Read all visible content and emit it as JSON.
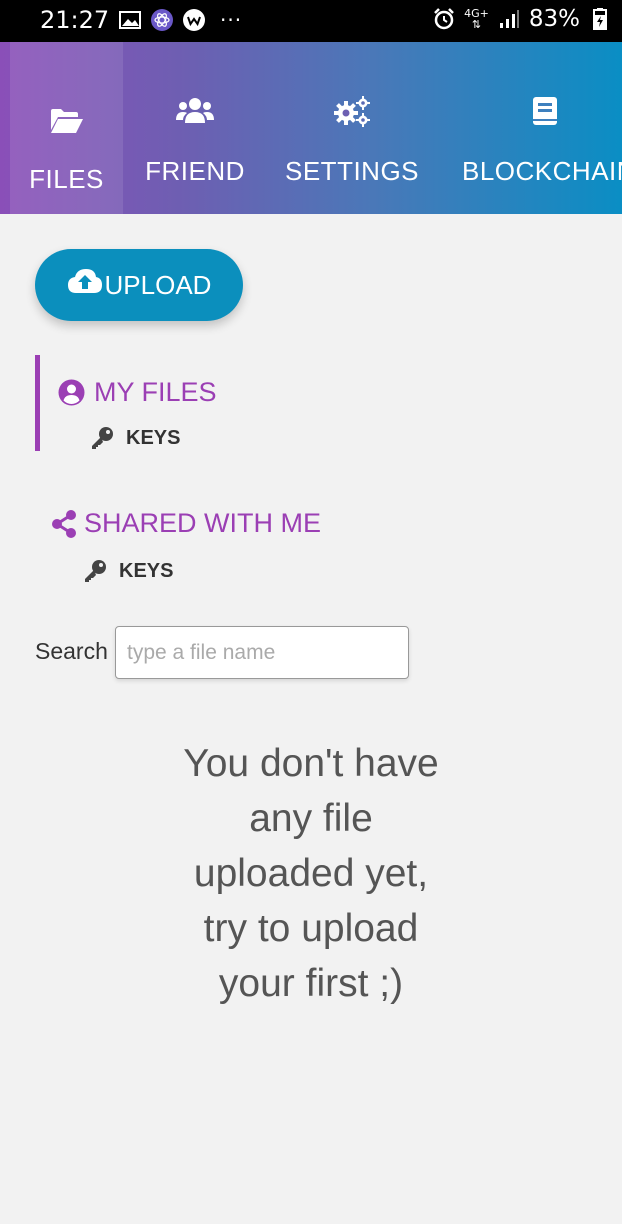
{
  "status_bar": {
    "time": "21:27",
    "dots": "···",
    "network": "4G+",
    "battery": "83%"
  },
  "nav": {
    "tabs": [
      {
        "label": "FILES",
        "icon": "folder-open-icon",
        "active": true
      },
      {
        "label": "FRIEND",
        "icon": "users-icon",
        "active": false
      },
      {
        "label": "SETTINGS",
        "icon": "cogs-icon",
        "active": false
      },
      {
        "label": "BLOCKCHAIN",
        "icon": "book-icon",
        "active": false
      }
    ]
  },
  "upload": {
    "label": "UPLOAD",
    "icon": "cloud-upload-icon"
  },
  "tree": {
    "my_files": {
      "label": "MY FILES",
      "icon": "user-circle-icon",
      "sub_label": "KEYS",
      "sub_icon": "key-icon"
    },
    "shared": {
      "label": "SHARED WITH ME",
      "icon": "share-icon",
      "sub_label": "KEYS",
      "sub_icon": "key-icon"
    }
  },
  "search": {
    "label": "Search",
    "placeholder": "type a file name",
    "value": ""
  },
  "empty_message": {
    "lines": [
      "You don't have",
      "any file",
      "uploaded yet,",
      "try to upload",
      "your first ;)"
    ]
  },
  "colors": {
    "accent_purple": "#9b3fb4",
    "upload_blue": "#0b8fbd",
    "nav_gradient_start": "#8a4fb8",
    "nav_gradient_end": "#0a8ec4",
    "background": "#f2f2f2"
  }
}
